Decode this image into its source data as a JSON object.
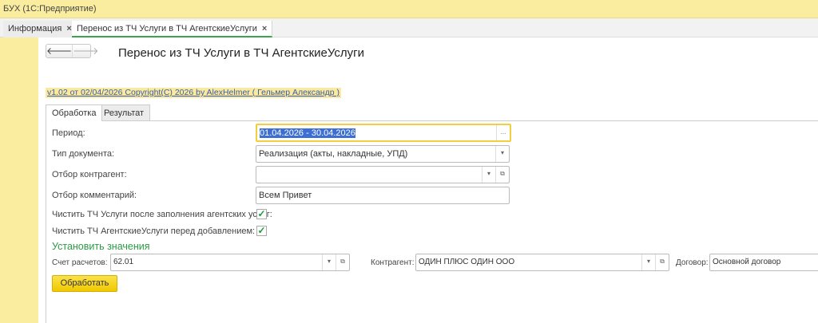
{
  "window": {
    "title": "БУХ  (1С:Предприятие)"
  },
  "window_tabs": [
    {
      "label": "Информация",
      "close": "×"
    },
    {
      "label": "Перенос из ТЧ Услуги в ТЧ АгентскиеУслуги",
      "close": "×"
    }
  ],
  "nav": {
    "back": "🡐",
    "forward": "🡒"
  },
  "page": {
    "title": "Перенос из ТЧ Услуги в ТЧ АгентскиеУслуги",
    "copyright": "v1.02 от 02/04/2026 Copyright(C) 2026 by AlexHelmer ( Гельмер Александр )"
  },
  "form_tabs": [
    "Обработка",
    "Результат"
  ],
  "fields": {
    "period": {
      "label": "Период:",
      "value": "01.04.2026 - 30.04.2026",
      "button": "..."
    },
    "doc_type": {
      "label": "Тип документа:",
      "value": "Реализация (акты, накладные, УПД)"
    },
    "counterparty_filter": {
      "label": "Отбор контрагент:",
      "value": ""
    },
    "comment_filter": {
      "label": "Отбор комментарий:",
      "value": "Всем Привет"
    },
    "clear_services": {
      "label": "Чистить ТЧ Услуги после заполнения агентских услуг:",
      "checked": true,
      "mark": "✓"
    },
    "clear_agent": {
      "label": "Чистить ТЧ АгентскиеУслуги перед добавлением:",
      "checked": true,
      "mark": "✓"
    }
  },
  "set_values": {
    "title": "Установить значения",
    "account": {
      "label": "Счет расчетов:",
      "value": "62.01"
    },
    "counterparty": {
      "label": "Контрагент:",
      "value": "ОДИН ПЛЮС ОДИН ООО"
    },
    "contract": {
      "label": "Договор:",
      "value": "Основной договор"
    }
  },
  "actions": {
    "process": "Обработать"
  },
  "icons": {
    "dropdown": "▾",
    "open": "⧉"
  },
  "colors": {
    "accent_yellow": "#fbeda0",
    "section_green": "#2c9a44",
    "button_yellow": "#f5d31e"
  }
}
